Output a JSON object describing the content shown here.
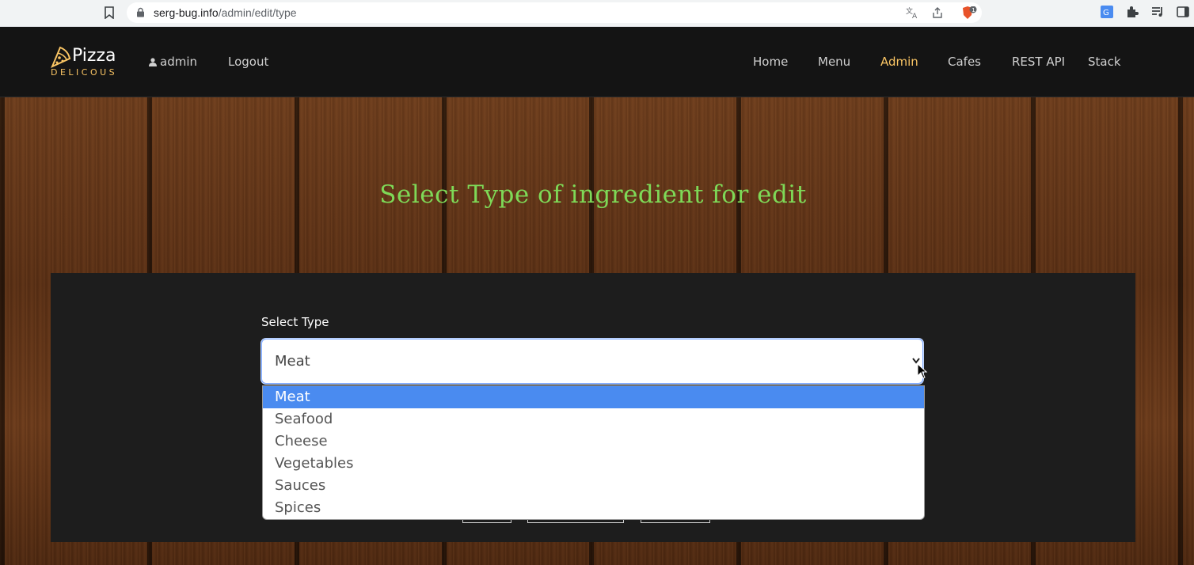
{
  "browser": {
    "url_host": "serg-bug.info",
    "url_path": "/admin/edit/type",
    "icons": [
      "bookmark-icon",
      "lock-icon",
      "translate-icon",
      "share-icon",
      "brave-shield-icon",
      "google-translate-ext-icon",
      "puzzle-extensions-icon",
      "reading-list-icon",
      "sidebar-icon"
    ],
    "brave_badge": "1"
  },
  "header": {
    "logo_main": "Pizza",
    "logo_sub": "DELICOUS",
    "user_label": "admin",
    "logout_label": "Logout",
    "nav": [
      {
        "label": "Home",
        "active": false
      },
      {
        "label": "Menu",
        "active": false
      },
      {
        "label": "Admin",
        "active": true
      },
      {
        "label": "Cafes",
        "active": false
      },
      {
        "label": "REST API",
        "active": false
      },
      {
        "label": "Stack",
        "active": false
      }
    ],
    "accent_color": "#fac564"
  },
  "main": {
    "title": "Select Type of ingredient for edit",
    "title_color": "#7ed957",
    "select_label": "Select Type",
    "select_value": "Meat",
    "options": [
      "Meat",
      "Seafood",
      "Cheese",
      "Vegetables",
      "Sauces",
      "Spices"
    ],
    "selected_option": "Meat",
    "highlight_color": "#4a8bf0"
  }
}
